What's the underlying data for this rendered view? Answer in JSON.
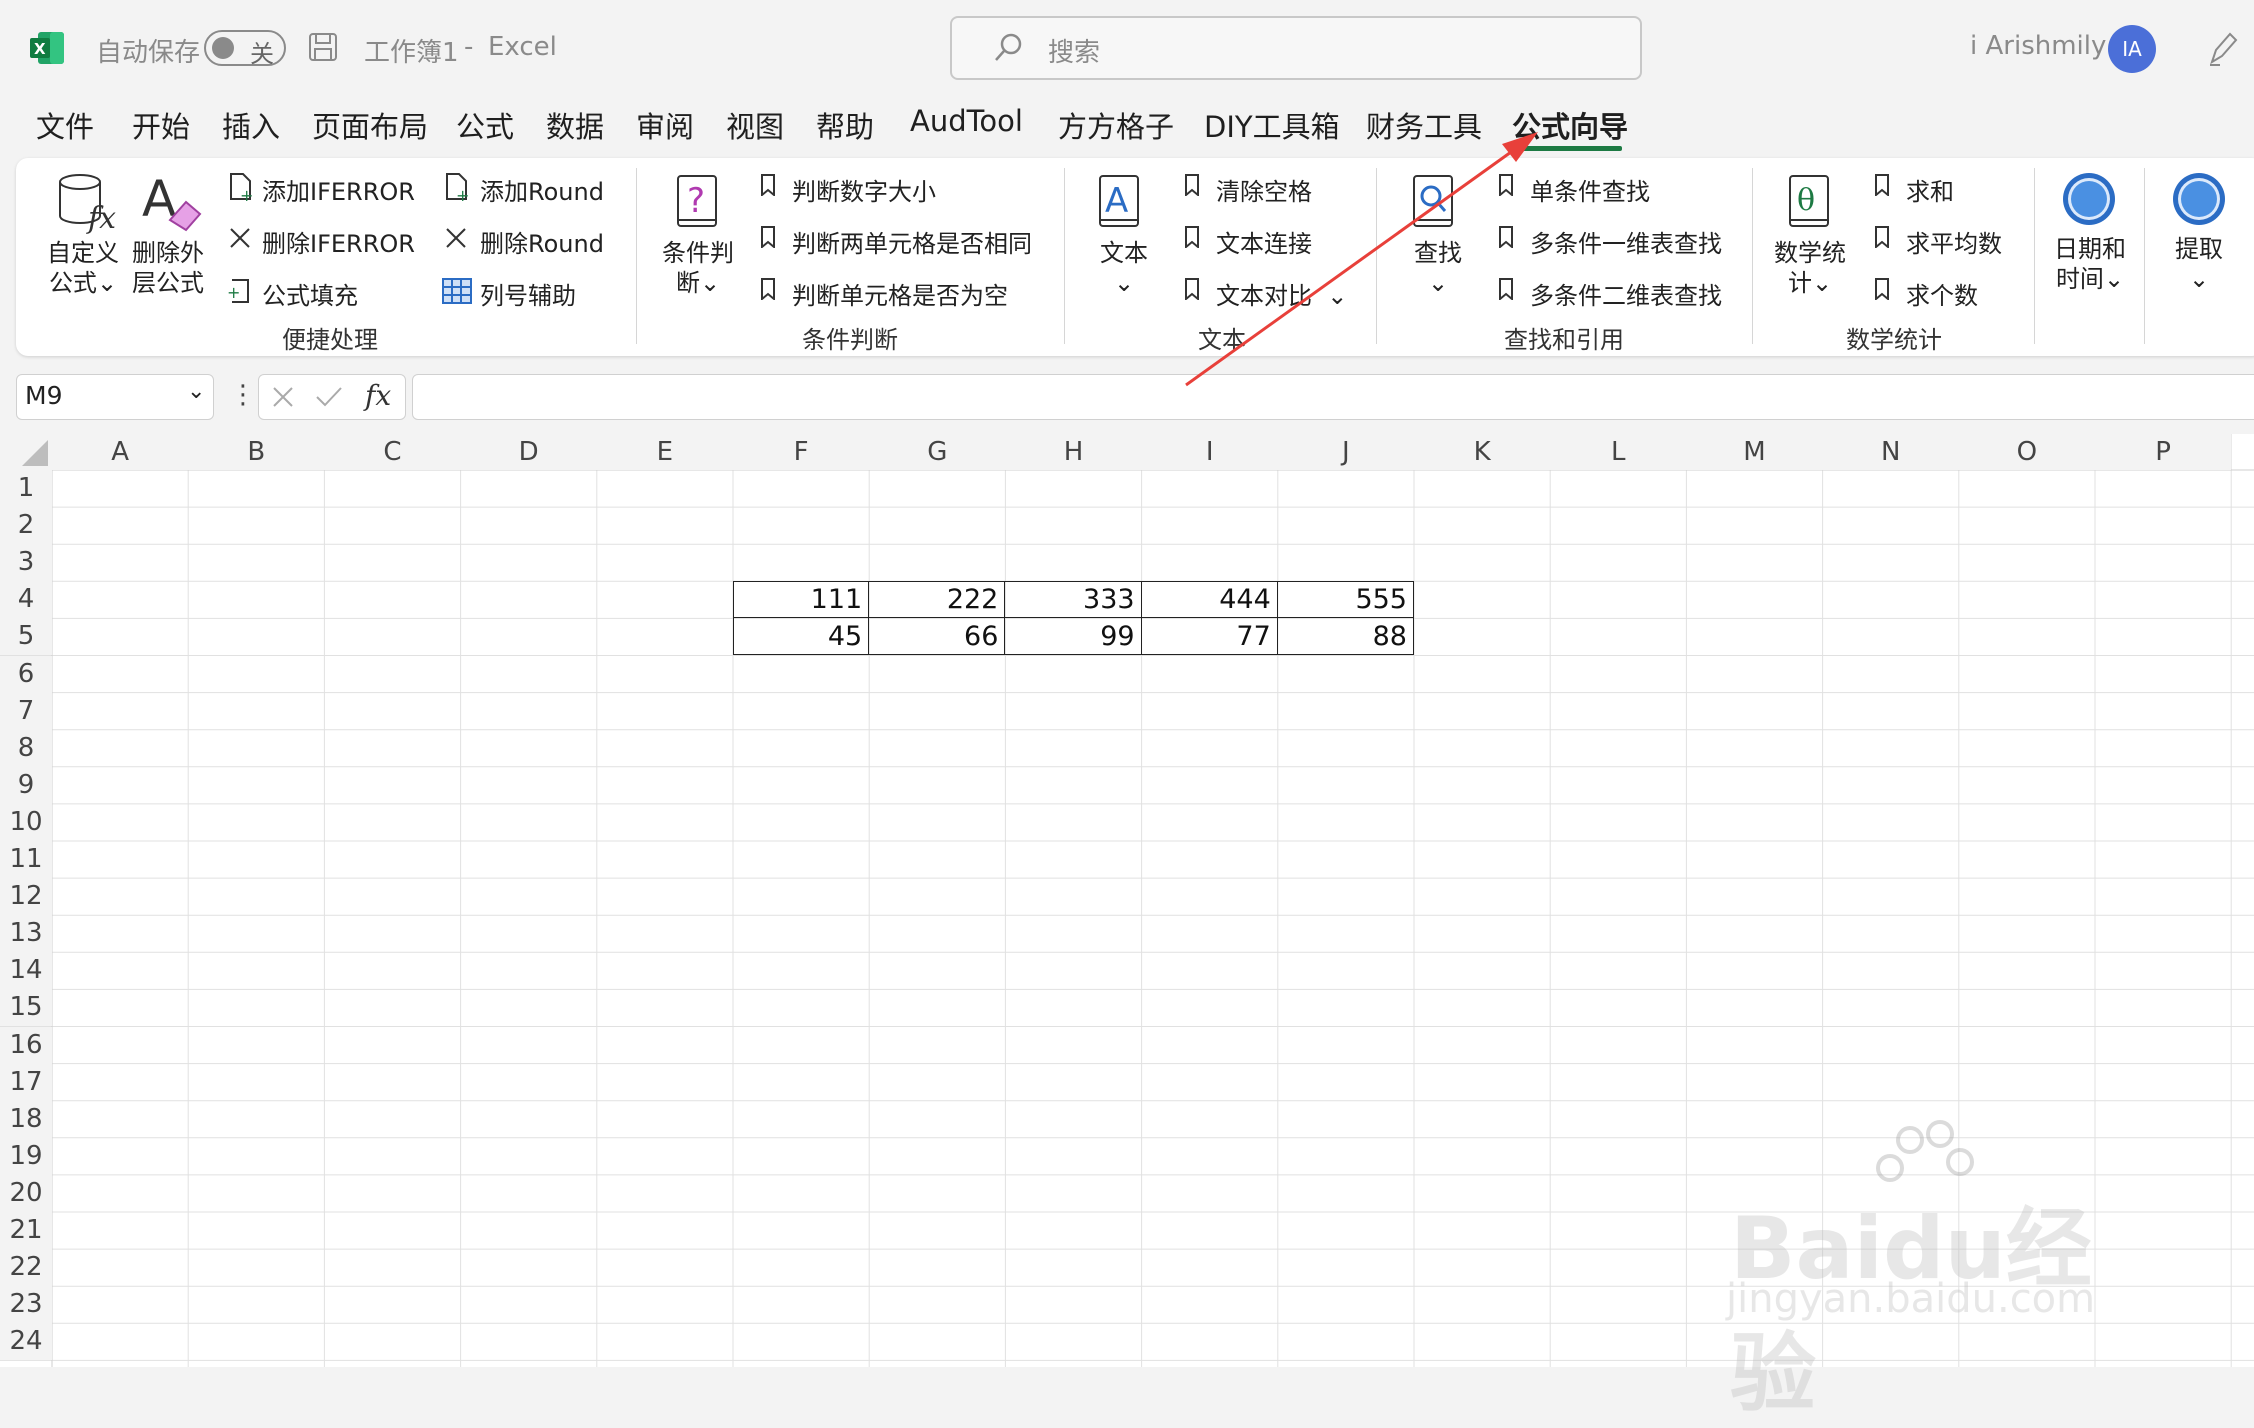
{
  "titlebar": {
    "autosave_label": "自动保存",
    "autosave_state": "关",
    "doc_name": "工作簿1",
    "separator": "-",
    "app_name": "Excel",
    "search_placeholder": "搜索",
    "user_name": "i Arishmily",
    "avatar_initials": "IA"
  },
  "menu_tabs": [
    "文件",
    "开始",
    "插入",
    "页面布局",
    "公式",
    "数据",
    "审阅",
    "视图",
    "帮助",
    "AudTool",
    "方方格子",
    "DIY工具箱",
    "财务工具",
    "公式向导"
  ],
  "active_tab": "公式向导",
  "ribbon": {
    "group1": {
      "label": "便捷处理",
      "big1": "自定义公式",
      "big2": "删除外层公式",
      "add_iferror": "添加IFERROR",
      "del_iferror": "删除IFERROR",
      "formula_fill": "公式填充",
      "add_round": "添加Round",
      "del_round": "删除Round",
      "col_assist": "列号辅助"
    },
    "group2": {
      "label": "条件判断",
      "big": "条件判断",
      "item1": "判断数字大小",
      "item2": "判断两单元格是否相同",
      "item3": "判断单元格是否为空"
    },
    "group3": {
      "label": "文本",
      "big": "文本",
      "item1": "清除空格",
      "item2": "文本连接",
      "item3": "文本对比"
    },
    "group4": {
      "label": "查找和引用",
      "big": "查找",
      "item1": "单条件查找",
      "item2": "多条件一维表查找",
      "item3": "多条件二维表查找"
    },
    "group5": {
      "label": "数学统计",
      "big": "数学统计",
      "item1": "求和",
      "item2": "求平均数",
      "item3": "求个数"
    },
    "group6": {
      "big": "日期和时间"
    },
    "group7": {
      "big": "提取"
    }
  },
  "formula_bar": {
    "name_box": "M9",
    "fx": "fx",
    "formula": ""
  },
  "columns": [
    "A",
    "B",
    "C",
    "D",
    "E",
    "F",
    "G",
    "H",
    "I",
    "J",
    "K",
    "L",
    "M",
    "N",
    "O",
    "P"
  ],
  "rows": [
    "1",
    "2",
    "3",
    "4",
    "5",
    "6",
    "7",
    "8",
    "9",
    "10",
    "11",
    "12",
    "13",
    "14",
    "15",
    "16",
    "17",
    "18",
    "19",
    "20",
    "21",
    "22",
    "23",
    "24"
  ],
  "cells": {
    "row4": [
      "111",
      "222",
      "333",
      "444",
      "555"
    ],
    "row5": [
      "45",
      "66",
      "99",
      "77",
      "88"
    ]
  },
  "watermark": {
    "brand": "Baidu经验",
    "url": "jingyan.baidu.com"
  },
  "colors": {
    "excel_green": "#1d7a43",
    "annotation_arrow": "#e8403a",
    "avatar": "#4b6fd8"
  }
}
